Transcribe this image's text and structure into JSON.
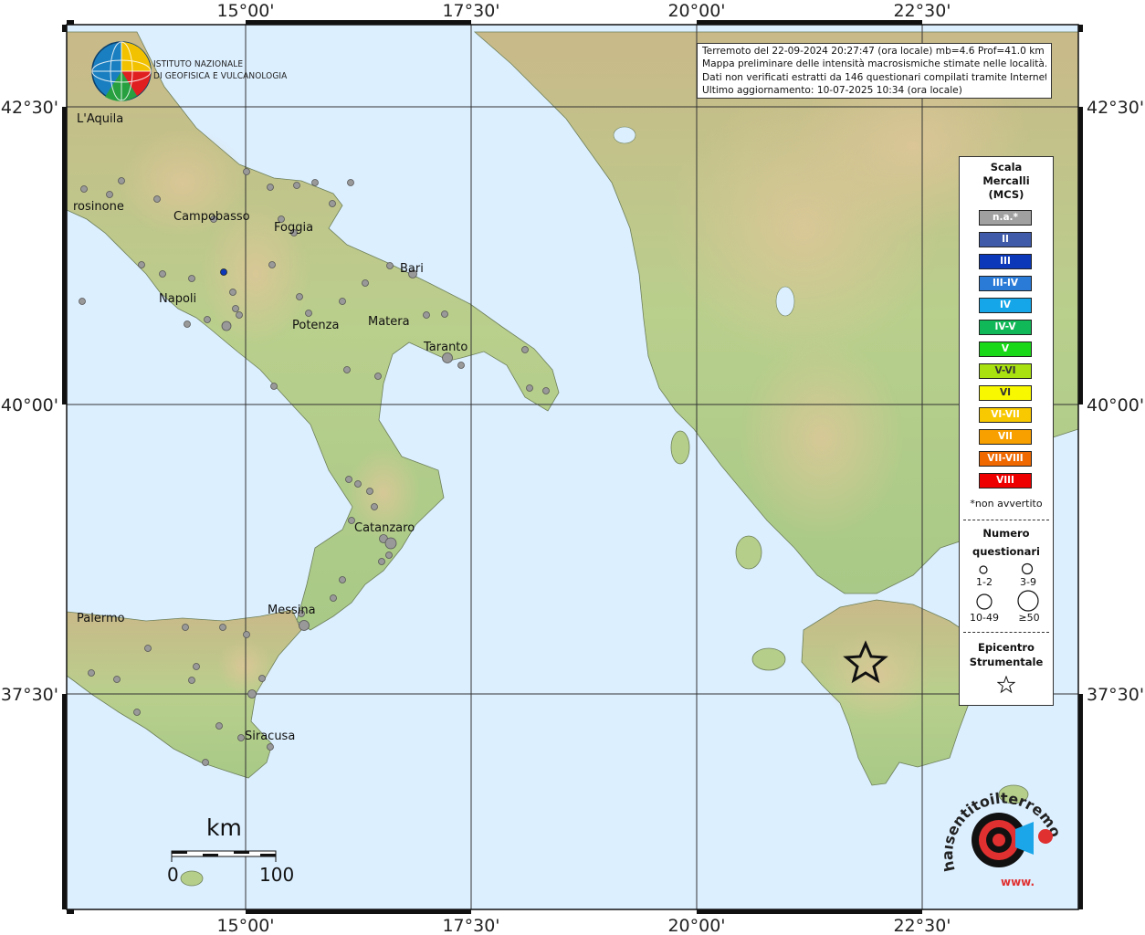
{
  "institution": {
    "name_line1": "ISTITUTO NAZIONALE",
    "name_line2": "DI GEOFISICA E VULCANOLOGIA"
  },
  "info": {
    "line1": "Terremoto del 22-09-2024 20:27:47 (ora locale) mb=4.6 Prof=41.0 km",
    "line2": "Mappa preliminare delle intensità macrosismiche stimate nelle località.",
    "line3": "Dati non verificati estratti da 146 questionari compilati tramite Internet.",
    "line4": "Ultimo aggiornamento: 10-07-2025 10:34 (ora locale)"
  },
  "axes": {
    "lon_ticks": [
      "15°00'",
      "17°30'",
      "20°00'",
      "22°30'"
    ],
    "lat_ticks": [
      "42°30'",
      "40°00'",
      "37°30'"
    ]
  },
  "cities": [
    {
      "name": "L'Aquila"
    },
    {
      "name": "rosinone"
    },
    {
      "name": "Campobasso"
    },
    {
      "name": "Foggia"
    },
    {
      "name": "Bari"
    },
    {
      "name": "Napoli"
    },
    {
      "name": "Potenza"
    },
    {
      "name": "Matera"
    },
    {
      "name": "Taranto"
    },
    {
      "name": "Catanzaro"
    },
    {
      "name": "Messina"
    },
    {
      "name": "Palermo"
    },
    {
      "name": "Siracusa"
    }
  ],
  "legend": {
    "scale_title1": "Scala",
    "scale_title2": "Mercalli",
    "scale_title3": "(MCS)",
    "classes": [
      {
        "label": "n.a.*",
        "color": "#a0a0a0"
      },
      {
        "label": "II",
        "color": "#3f5aa8"
      },
      {
        "label": "III",
        "color": "#0a38b8"
      },
      {
        "label": "III-IV",
        "color": "#2a7ad8"
      },
      {
        "label": "IV",
        "color": "#14a6e8"
      },
      {
        "label": "IV-V",
        "color": "#10b858"
      },
      {
        "label": "V",
        "color": "#18d818"
      },
      {
        "label": "V-VI",
        "color": "#a8e010"
      },
      {
        "label": "VI",
        "color": "#f8f800"
      },
      {
        "label": "VI-VII",
        "color": "#f8c800"
      },
      {
        "label": "VII",
        "color": "#f8a000"
      },
      {
        "label": "VII-VIII",
        "color": "#f06800"
      },
      {
        "label": "VIII",
        "color": "#ee0000"
      }
    ],
    "not_felt_note": "*non avvertito",
    "count_title1": "Numero",
    "count_title2": "questionari",
    "count_classes": [
      "1-2",
      "3-9",
      "10-49",
      "≥50"
    ],
    "epicenter_title1": "Epicentro",
    "epicenter_title2": "Strumentale"
  },
  "scale_bar": {
    "unit": "km",
    "start": "0",
    "end": "100"
  },
  "site_logo": {
    "text": "haisentitoilterremoto.it",
    "url_text": "www."
  },
  "colors": {
    "sea": "#dcefff",
    "land": "#b5cf8a",
    "highland": "#d9b07a",
    "grid": "#333333"
  }
}
